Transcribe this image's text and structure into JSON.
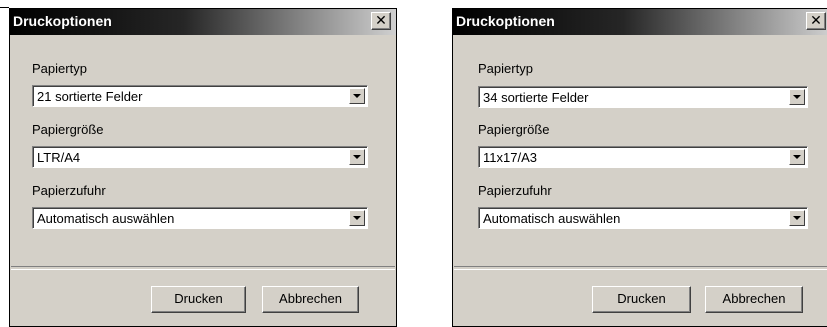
{
  "dialogs": [
    {
      "title": "Druckoptionen",
      "close_glyph": "✕",
      "paper_type": {
        "label": "Papiertyp",
        "value": "21 sortierte Felder"
      },
      "paper_size": {
        "label": "Papiergröße",
        "value": "LTR/A4"
      },
      "paper_feed": {
        "label": "Papierzufuhr",
        "value": "Automatisch auswählen"
      },
      "print_label": "Drucken",
      "cancel_label": "Abbrechen"
    },
    {
      "title": "Druckoptionen",
      "close_glyph": "✕",
      "paper_type": {
        "label": "Papiertyp",
        "value": "34 sortierte Felder"
      },
      "paper_size": {
        "label": "Papiergröße",
        "value": "11x17/A3"
      },
      "paper_feed": {
        "label": "Papierzufuhr",
        "value": "Automatisch auswählen"
      },
      "print_label": "Drucken",
      "cancel_label": "Abbrechen"
    }
  ],
  "icons": {
    "close": "close-icon",
    "dropdown": "chevron-down-icon"
  },
  "colors": {
    "dialog_bg": "#d4d0c8",
    "titlebar_start": "#000000",
    "titlebar_end": "#d0d0d0"
  }
}
